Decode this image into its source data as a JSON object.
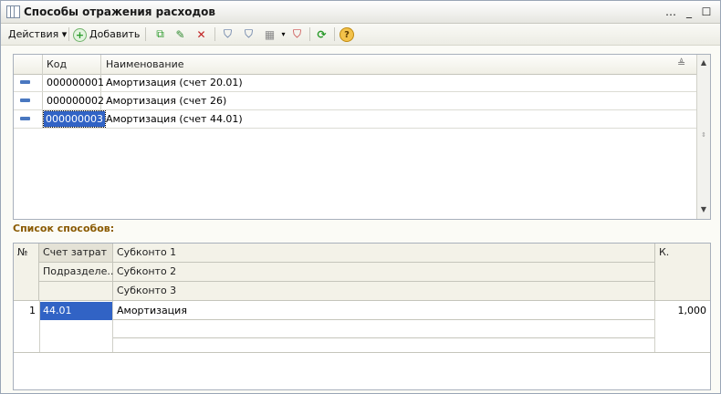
{
  "window": {
    "title": "Способы отражения расходов"
  },
  "toolbar": {
    "actions_label": "Действия",
    "add_label": "Добавить"
  },
  "list": {
    "columns": {
      "code": "Код",
      "name": "Наименование"
    },
    "rows": [
      {
        "code": "000000001",
        "name": "Амортизация (счет 20.01)"
      },
      {
        "code": "000000002",
        "name": "Амортизация (счет 26)"
      },
      {
        "code": "000000003",
        "name": "Амортизация (счет 44.01)"
      }
    ]
  },
  "methods": {
    "title": "Список способов:",
    "headers": {
      "no": "№",
      "account": "Счет затрат",
      "dept": "Подразделе...",
      "sub1": "Субконто 1",
      "sub2": "Субконто 2",
      "sub3": "Субконто 3",
      "k": "К."
    },
    "rows": [
      {
        "no": "1",
        "account": "44.01",
        "sub1": "Амортизация",
        "k": "1,000"
      }
    ]
  },
  "colors": {
    "selection": "#3163c5",
    "section_title": "#8a5a00"
  }
}
